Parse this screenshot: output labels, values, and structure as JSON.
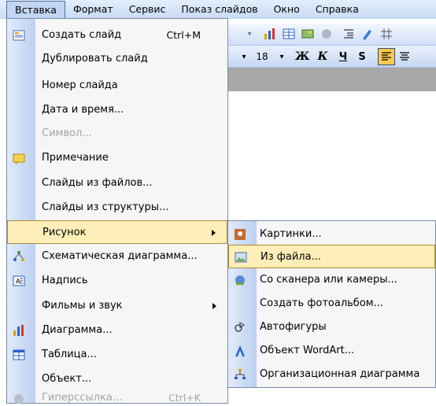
{
  "menubar": [
    {
      "id": "insert",
      "label": "Вставка"
    },
    {
      "id": "format",
      "label": "Формат"
    },
    {
      "id": "tools",
      "label": "Сервис"
    },
    {
      "id": "slideshow",
      "label": "Показ слайдов"
    },
    {
      "id": "window",
      "label": "Окно"
    },
    {
      "id": "help",
      "label": "Справка"
    }
  ],
  "toolbar": {
    "font_size": "18",
    "bold": "Ж",
    "italic": "К",
    "underline": "Ч",
    "shadow": "S"
  },
  "menu": [
    {
      "label": "Создать слайд",
      "shortcut": "Ctrl+M",
      "icon": "new-slide-icon"
    },
    {
      "label": "Дублировать слайд"
    },
    {
      "label": "Номер слайда"
    },
    {
      "label": "Дата и время..."
    },
    {
      "label": "Символ...",
      "disabled": true
    },
    {
      "label": "Примечание",
      "icon": "comment-icon"
    },
    {
      "label": "Слайды из файлов..."
    },
    {
      "label": "Слайды из структуры..."
    },
    {
      "label": "Рисунок",
      "submenu": true
    },
    {
      "label": "Схематическая диаграмма...",
      "icon": "diagram-icon"
    },
    {
      "label": "Надпись",
      "icon": "textbox-icon"
    },
    {
      "label": "Фильмы и звук",
      "submenu": true
    },
    {
      "label": "Диаграмма...",
      "icon": "chart-icon"
    },
    {
      "label": "Таблица...",
      "icon": "table-icon"
    },
    {
      "label": "Объект..."
    },
    {
      "label": "Гиперссылка...",
      "shortcut": "Ctrl+K",
      "disabled": true,
      "icon": "hyperlink-icon"
    }
  ],
  "submenu": [
    {
      "label": "Картинки...",
      "icon": "clipart-icon"
    },
    {
      "label": "Из файла...",
      "icon": "picture-from-file-icon"
    },
    {
      "label": "Со сканера или камеры...",
      "icon": "scanner-icon"
    },
    {
      "label": "Создать фотоальбом..."
    },
    {
      "label": "Автофигуры",
      "icon": "autoshapes-icon"
    },
    {
      "label": "Объект WordArt...",
      "icon": "wordart-icon"
    },
    {
      "label": "Организационная диаграмма",
      "icon": "org-chart-icon"
    }
  ]
}
